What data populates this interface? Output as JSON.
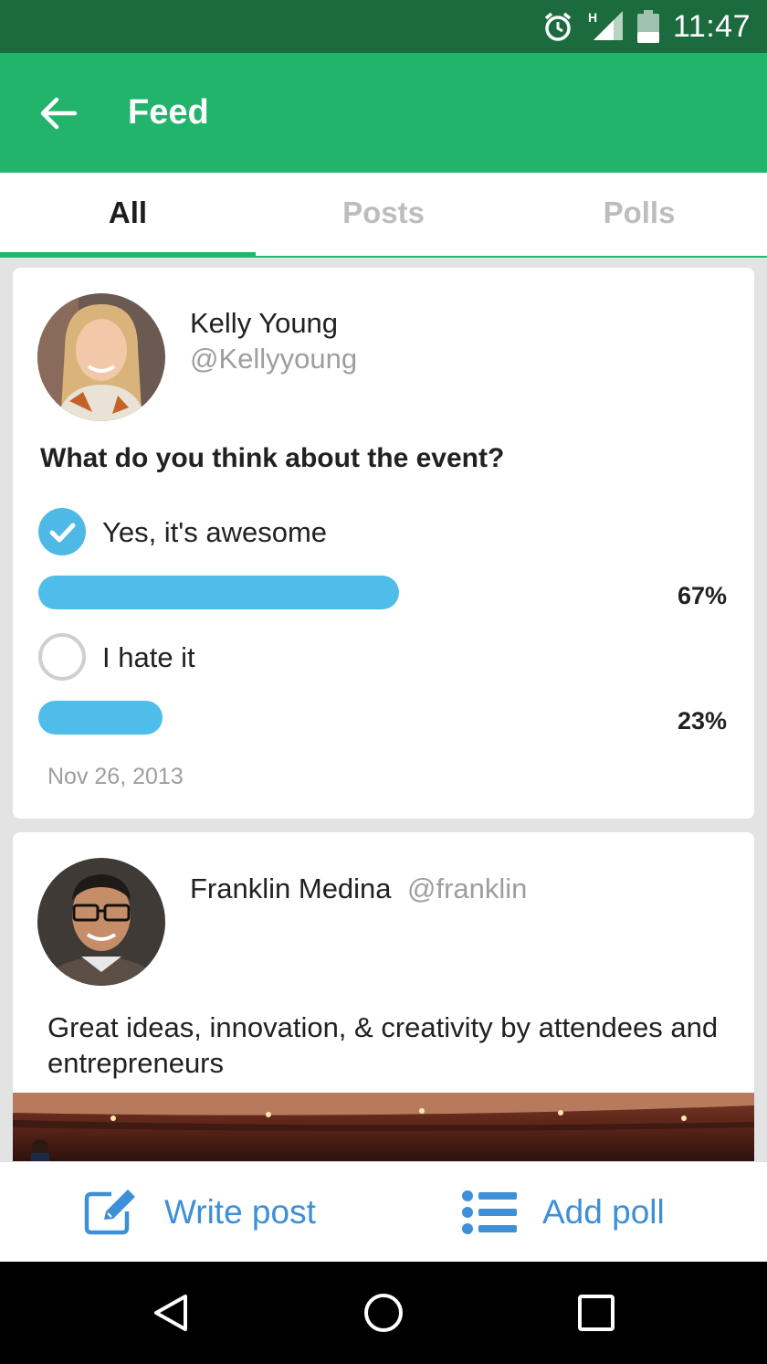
{
  "status_bar": {
    "time": "11:47",
    "network_label": "H",
    "icons": [
      "alarm-icon",
      "signal-icon",
      "battery-icon"
    ]
  },
  "app_bar": {
    "title": "Feed",
    "back_icon": "arrow-left-icon"
  },
  "tabs": [
    {
      "label": "All",
      "active": true
    },
    {
      "label": "Posts",
      "active": false
    },
    {
      "label": "Polls",
      "active": false
    }
  ],
  "feed": [
    {
      "type": "poll",
      "author_name": "Kelly Young",
      "author_handle": "@Kellyyoung",
      "question": "What do you think about the event?",
      "options": [
        {
          "label": "Yes, it's awesome",
          "percent_text": "67%",
          "fraction": 0.67,
          "selected": true
        },
        {
          "label": "I hate it",
          "percent_text": "23%",
          "fraction": 0.23,
          "selected": false
        }
      ],
      "date": "Nov 26, 2013"
    },
    {
      "type": "post",
      "author_name": "Franklin Medina",
      "author_handle": "@franklin",
      "text": "Great ideas, innovation, & creativity by attendees and entrepreneurs"
    }
  ],
  "bottom_actions": {
    "write_post": "Write post",
    "add_poll": "Add poll"
  },
  "colors": {
    "status_bar": "#1c6b3f",
    "app_bar": "#23b46c",
    "accent": "#23b46c",
    "poll_bar": "#4fbde9",
    "action_text": "#3d8fd8"
  }
}
